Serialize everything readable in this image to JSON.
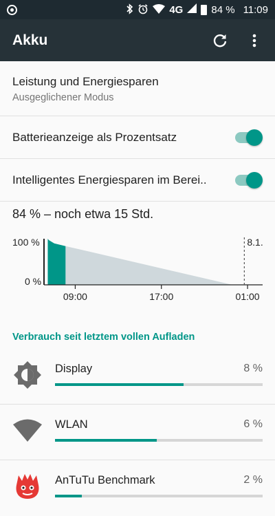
{
  "status_bar": {
    "signal": "4G",
    "battery_percent": "84 %",
    "time": "11:09"
  },
  "toolbar": {
    "title": "Akku",
    "refresh_icon": "refresh-icon",
    "overflow_icon": "more-vertical-icon"
  },
  "preferences": {
    "power_mode": {
      "title": "Leistung und Energiesparen",
      "summary": "Ausgeglichener Modus"
    },
    "battery_percent_toggle": {
      "label": "Batterieanzeige als Prozentsatz",
      "on": true
    },
    "smart_saving_toggle": {
      "label": "Intelligentes Energiesparen im Berei..",
      "on": true
    }
  },
  "battery_summary": "84 % – noch etwa 15 Std.",
  "chart_data": {
    "type": "area",
    "y_tick_labels": [
      "100 %",
      "0 %"
    ],
    "x_tick_labels": [
      "09:00",
      "17:00",
      "01:00"
    ],
    "end_marker_label": "8.1.",
    "ylim": [
      0,
      100
    ],
    "history": {
      "x_hours": [
        6.45,
        6.55,
        7.05,
        8.1
      ],
      "y_percent": [
        100,
        97,
        90,
        84
      ]
    },
    "projection": {
      "x_hours": [
        8.1,
        23.6
      ],
      "y_percent": [
        84,
        0
      ]
    },
    "x_range_hours": [
      6.1,
      26.4
    ],
    "end_marker_hours": 24.7,
    "colors": {
      "history": "#009688",
      "projection": "#cfd8dc"
    }
  },
  "usage": {
    "header": "Verbrauch seit letztem vollen Aufladen",
    "items": [
      {
        "name": "Display",
        "percent_label": "8 %",
        "bar_fraction": 0.62,
        "icon": "brightness-icon"
      },
      {
        "name": "WLAN",
        "percent_label": "6 %",
        "bar_fraction": 0.49,
        "icon": "wifi-icon"
      },
      {
        "name": "AnTuTu Benchmark",
        "percent_label": "2 %",
        "bar_fraction": 0.13,
        "icon": "antutu-app-icon"
      }
    ]
  },
  "colors": {
    "accent": "#009688",
    "toolbar": "#263238",
    "status_bar": "#1e2a31"
  }
}
